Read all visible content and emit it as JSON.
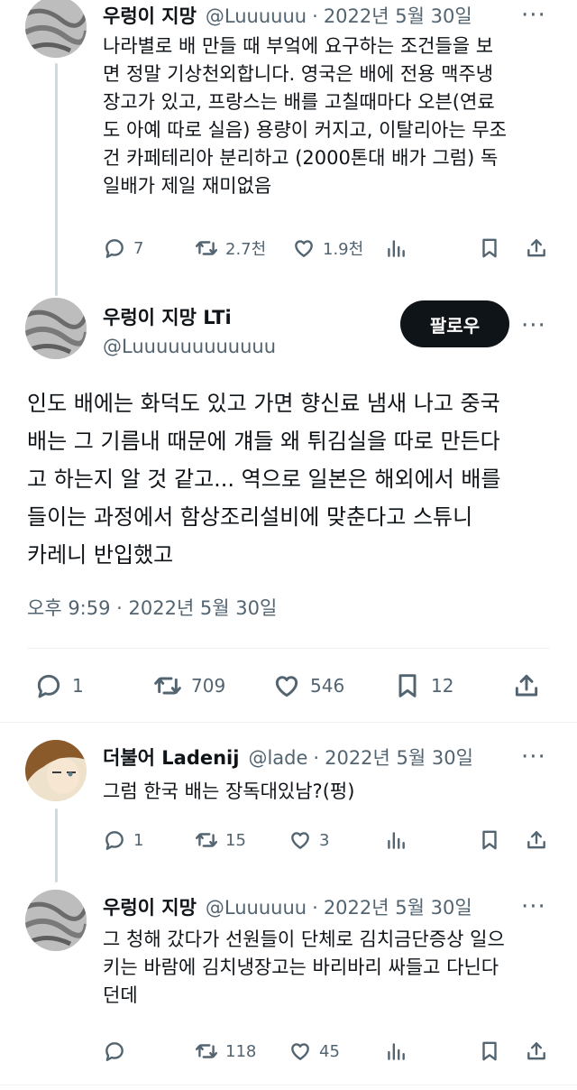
{
  "tweet1": {
    "name": "우렁이 지망",
    "handle": "@Luuuuuu",
    "separator": "·",
    "date": "2022년 5월 30일",
    "more": "···",
    "text": "나라별로 배 만들 때 부엌에 요구하는 조건들을 보\n면 정말 기상천외합니다. 영국은 배에 전용 맥주냉\n장고가 있고, 프랑스는 배를 고칠때마다 오븐(연료\n도 아예 따로 실음) 용량이 커지고, 이탈리아는 무조\n건 카페테리아 분리하고 (2000톤대 배가 그럼) 독\n일배가 제일 재미없음",
    "replies": "7",
    "retweets": "2.7천",
    "likes": "1.9천"
  },
  "main_tweet": {
    "name": "우렁이 지망 LTi",
    "handle": "@Luuuuuuuuuuuu",
    "follow_label": "팔로우",
    "more": "···",
    "text": "인도 배에는 화덕도 있고 가면 향신료 냄새 나고 중국\n배는 그 기름내 때문에 걔들 왜 튀김실을 따로 만든다\n고 하는지 알 것 같고... 역으로 일본은 해외에서 배를\n들이는 과정에서 함상조리설비에 맞춘다고 스튜니\n카레니 반입했고",
    "timestamp": "오후 9:59 · 2022년 5월 30일",
    "replies": "1",
    "retweets": "709",
    "likes": "546",
    "bookmarks": "12"
  },
  "reply1": {
    "name": "더불어 Ladenij",
    "handle": "@lade",
    "separator": "·",
    "date": "2022년 5월 30일",
    "more": "···",
    "text": "그럼 한국 배는 장독대있남?(펑)",
    "replies": "1",
    "retweets": "15",
    "likes": "3"
  },
  "reply2": {
    "name": "우렁이 지망",
    "handle": "@Luuuuuu",
    "separator": "·",
    "date": "2022년 5월 30일",
    "more": "···",
    "text": "그 청해 갔다가 선원들이 단체로 김치금단증상 일으\n키는 바람에 김치냉장고는 바리바리 싸들고 다닌다\n던데",
    "replies": "",
    "retweets": "118",
    "likes": "45"
  },
  "icons": [
    "reply-icon",
    "retweet-icon",
    "like-icon",
    "views-icon",
    "bookmark-icon",
    "share-icon",
    "more-icon"
  ],
  "colors": {
    "text": "#0f1419",
    "secondary": "#536471",
    "divider": "#eff3f4",
    "button": "#0f1419"
  }
}
